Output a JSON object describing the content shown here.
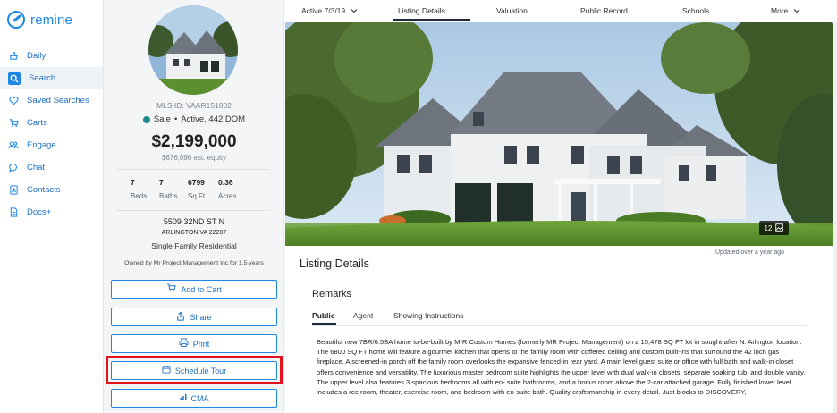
{
  "app": {
    "logo_text": "remine"
  },
  "nav": {
    "items": [
      {
        "label": "Daily",
        "icon": "hand-icon"
      },
      {
        "label": "Search",
        "icon": "search-icon",
        "active": true
      },
      {
        "label": "Saved Searches",
        "icon": "heart-icon"
      },
      {
        "label": "Carts",
        "icon": "cart-icon"
      },
      {
        "label": "Engage",
        "icon": "people-icon"
      },
      {
        "label": "Chat",
        "icon": "chat-icon"
      },
      {
        "label": "Contacts",
        "icon": "contacts-icon"
      },
      {
        "label": "Docs+",
        "icon": "document-icon"
      }
    ]
  },
  "property": {
    "mls_id": "MLS ID: VAAR151802",
    "sale_label": "Sale",
    "status_text": "Active, 442 DOM",
    "price": "$2,199,000",
    "equity": "$676,090 est. equity",
    "stats": [
      {
        "value": "7",
        "label": "Beds"
      },
      {
        "value": "7",
        "label": "Baths"
      },
      {
        "value": "6799",
        "label": "Sq Ft"
      },
      {
        "value": "0.36",
        "label": "Acres"
      }
    ],
    "address_line1": "5509 32ND ST N",
    "address_line2": "ARLINGTON VA 22207",
    "property_type": "Single Family Residential",
    "owned_by": "Owned by Mr Project Management Inc for 1.5 years"
  },
  "actions": {
    "add_to_cart": "Add to Cart",
    "share": "Share",
    "print": "Print",
    "schedule_tour": "Schedule Tour",
    "cma": "CMA"
  },
  "tabs": {
    "active_date": "Active 7/3/19",
    "listing_details": "Listing Details",
    "valuation": "Valuation",
    "public_record": "Public Record",
    "schools": "Schools",
    "more": "More"
  },
  "hero": {
    "photo_count": "12",
    "updated": "Updated over a year ago"
  },
  "listing": {
    "section_title": "Listing Details",
    "remarks_title": "Remarks",
    "remark_tabs": [
      "Public",
      "Agent",
      "Showing Instructions"
    ],
    "description": "Beautiful new 7BR/6.5BA home to-be-built by M-R Custom Homes (formerly MR Project Management) on a 15,478 SQ FT lot in sought-after N. Arlington location. The 6800 SQ FT home will feature a gourmet kitchen that opens to the family room with coffered ceiling and custom built-ins that surround the 42 inch gas fireplace. A screened-in porch off the family room overlooks the expansive fenced-in rear yard. A main level guest suite or office with full bath and walk-in closet offers convenience and versatility. The luxurious master bedroom suite highlights the upper level with dual walk-in closets, separate soaking tub, and double vanity. The upper level also features 3 spacious bedrooms all with en- suite bathrooms, and a bonus room above the 2-car attached garage. Fully finished lower level includes a rec room, theater, exercise room, and bedroom with en-suite bath. Quality craftsmanship in every detail. Just blocks to DISCOVERY,"
  }
}
